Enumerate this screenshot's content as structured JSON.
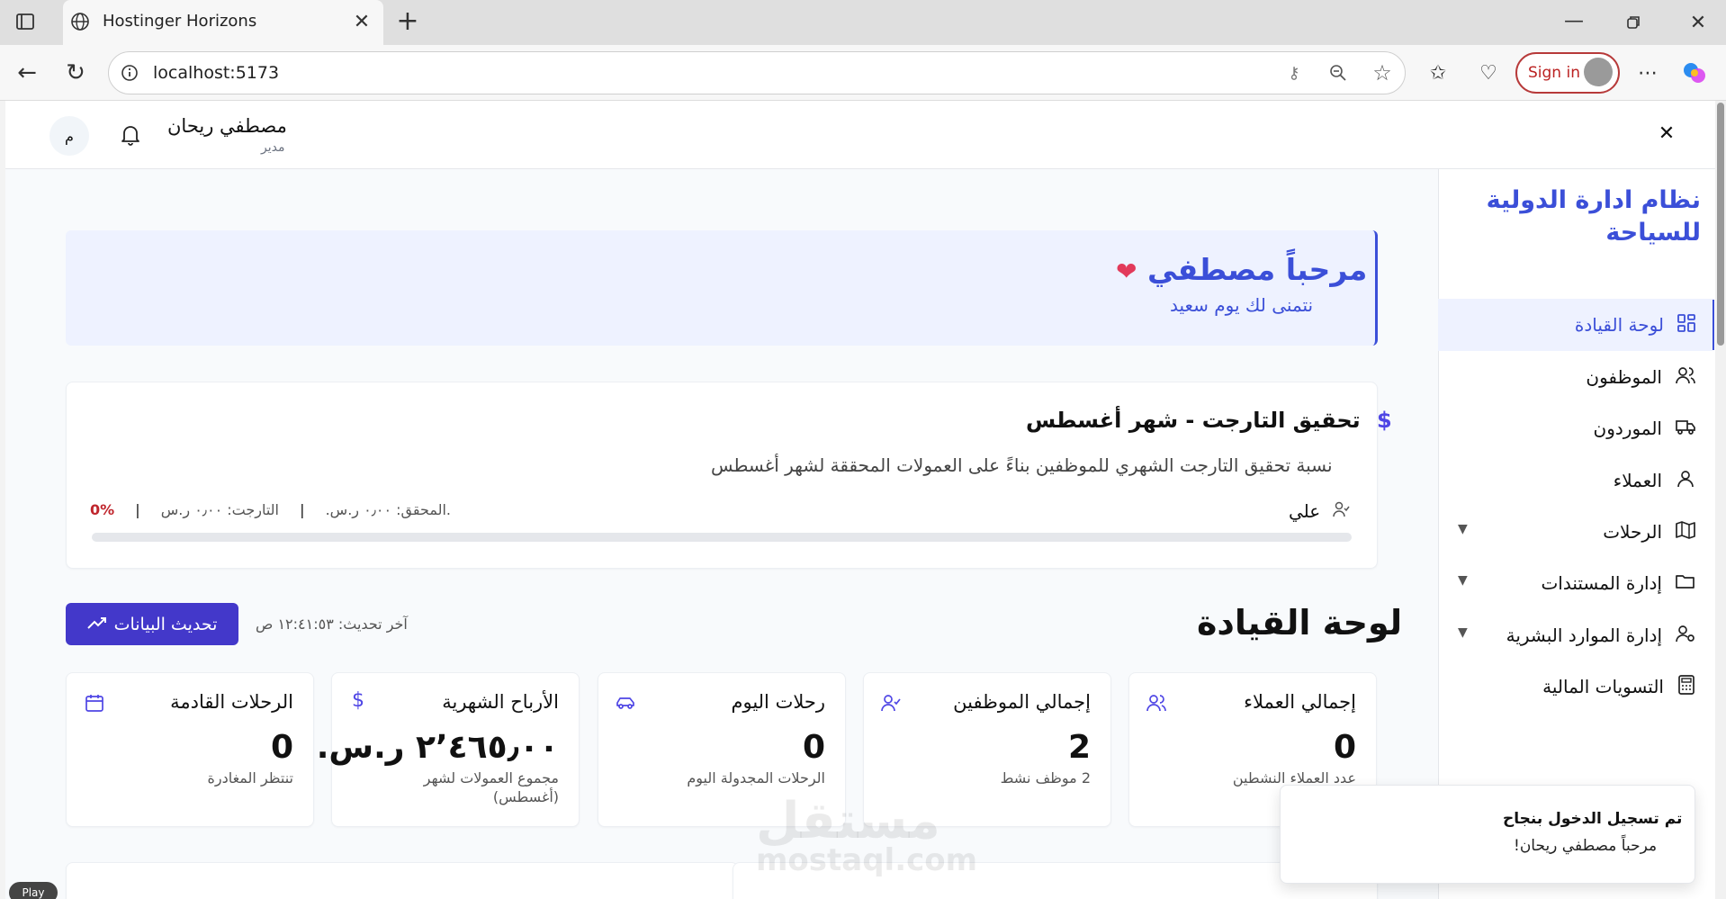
{
  "browser": {
    "tab_title": "Hostinger Horizons",
    "address": "localhost:5173",
    "signin_label": "Sign in"
  },
  "header": {
    "user_name": "مصطفي ريحان",
    "user_role": "مدير",
    "avatar_initial": "م"
  },
  "sidebar": {
    "brand": "نظام ادارة الدولية للسياحة",
    "items": [
      {
        "label": "لوحة القيادة",
        "icon": "dashboard-icon",
        "active": true
      },
      {
        "label": "الموظفون",
        "icon": "users-icon"
      },
      {
        "label": "الموردون",
        "icon": "truck-icon"
      },
      {
        "label": "العملاء",
        "icon": "user-icon"
      },
      {
        "label": "الرحلات",
        "icon": "map-icon",
        "expandable": true
      },
      {
        "label": "إدارة المستندات",
        "icon": "folder-icon",
        "expandable": true
      },
      {
        "label": "إدارة الموارد البشرية",
        "icon": "user-cog-icon",
        "expandable": true
      },
      {
        "label": "التسويات المالية",
        "icon": "calculator-icon"
      }
    ]
  },
  "welcome": {
    "title": "مرحباً مصطفي",
    "subtitle": "نتمنى لك يوم سعيد"
  },
  "target": {
    "title": "تحقيق التارجت - شهر أغسطس",
    "description": "نسبة تحقيق التارجت الشهري للموظفين بناءً على العمولات المحققة لشهر أغسطس",
    "employee": "علي",
    "target_text": "التارجت: ٠٫٠٠ ر.س.",
    "achieved_text": "المحقق: ٠٫٠٠ ر.س.",
    "percent_text": "0%",
    "progress": 0,
    "separator": "|"
  },
  "dashboard": {
    "title": "لوحة القيادة",
    "refresh_label": "تحديث البيانات",
    "last_update": "آخر تحديث: ١٢:٤١:٥٣ ص"
  },
  "stats": [
    {
      "title": "إجمالي العملاء",
      "value": "0",
      "sub": "عدد العملاء النشطين",
      "icon": "users-icon"
    },
    {
      "title": "إجمالي الموظفين",
      "value": "2",
      "sub": "2 موظف نشط",
      "icon": "user-check-icon"
    },
    {
      "title": "رحلات اليوم",
      "value": "0",
      "sub": "الرحلات المجدولة اليوم",
      "icon": "car-icon"
    },
    {
      "title": "الأرباح الشهرية",
      "value": "٢٬٤٦٥٫٠٠ ر.س.",
      "sub": "مجموع العمولات لشهر (أغسطس)",
      "icon": "dollar-icon"
    },
    {
      "title": "الرحلات القادمة",
      "value": "0",
      "sub": "تنتظر المغادرة",
      "icon": "calendar-icon"
    }
  ],
  "toast": {
    "title": "تم تسجيل الدخول بنجاح",
    "description": "مرحباً مصطفي ريحان!"
  },
  "watermark": {
    "arabic": "مستقل",
    "latin": "mostaql.com"
  },
  "play_label": "Play",
  "colors": {
    "accent": "#3b4fd8",
    "button": "#4338ca",
    "percent": "#c0262d"
  }
}
